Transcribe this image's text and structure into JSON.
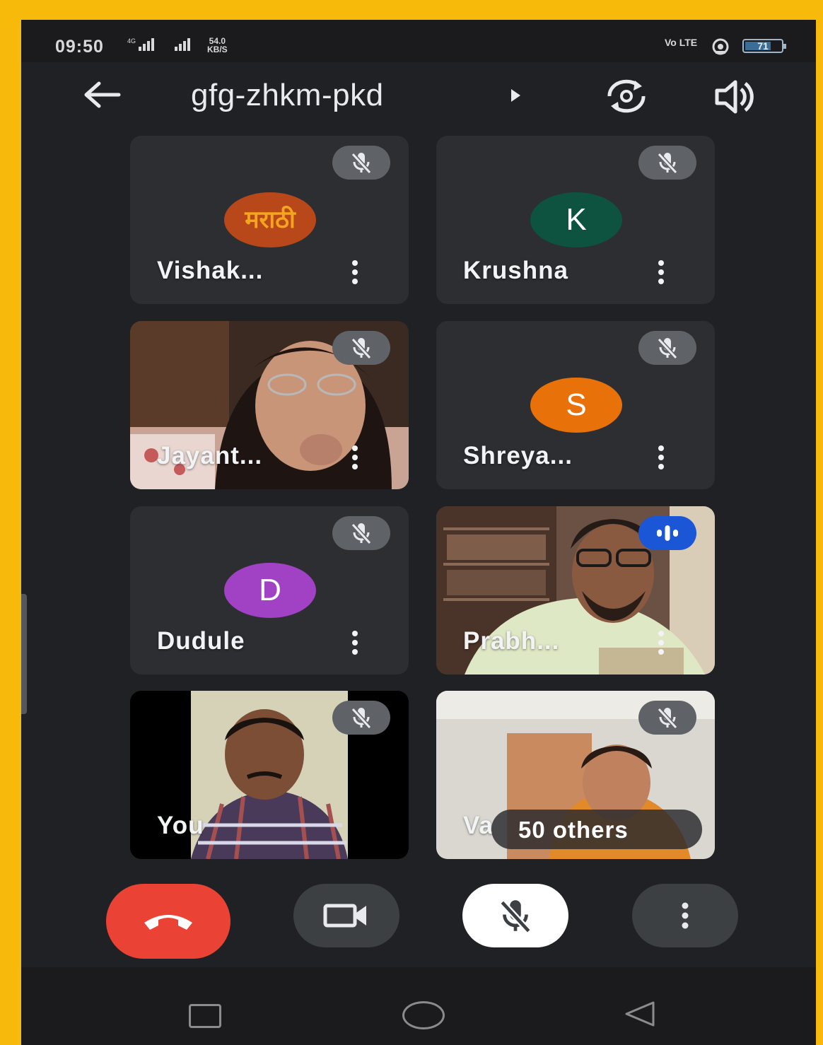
{
  "status_bar": {
    "time": "09:50",
    "signal_1": "⁴ᴳ.ıl",
    "signal_2": ".ıl",
    "net_speed_value": "54.0",
    "net_speed_unit": "KB/S",
    "volte": "Vo LTE",
    "battery": "71"
  },
  "header": {
    "meeting_code": "gfg-zhkm-pkd"
  },
  "participants": [
    {
      "name": "Vishak...",
      "avatar_letter": "",
      "avatar_text": "मराठी",
      "muted": true
    },
    {
      "name": "Krushna",
      "avatar_letter": "K",
      "avatar_color": "#0d5340",
      "muted": true
    },
    {
      "name": "Jayant...",
      "video": true,
      "muted": true
    },
    {
      "name": "Shreya...",
      "avatar_letter": "S",
      "avatar_color": "#e8710a",
      "muted": true
    },
    {
      "name": "Dudule",
      "avatar_letter": "D",
      "avatar_color": "#a142c4",
      "muted": true
    },
    {
      "name": "Prabh...",
      "video": true,
      "speaking": true
    },
    {
      "name": "You",
      "video": true,
      "muted": true
    },
    {
      "name": "Va",
      "video": true,
      "muted": true
    }
  ],
  "others_pill": "50 others",
  "colors": {
    "end_call": "#ea4335",
    "speaking": "#1a56d6",
    "tile_bg": "#2d2e31",
    "frame": "#f7b90a"
  }
}
